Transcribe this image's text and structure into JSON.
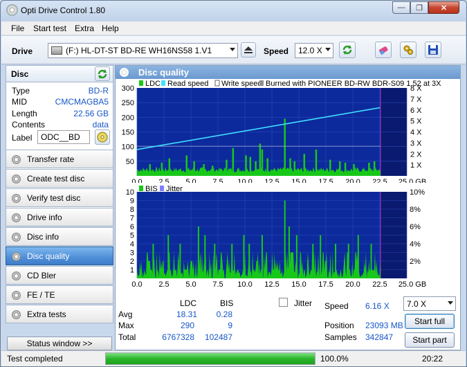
{
  "window": {
    "title": "Opti Drive Control 1.80",
    "min": "—",
    "max": "❐",
    "close": "✕"
  },
  "menu": [
    "File",
    "Start test",
    "Extra",
    "Help"
  ],
  "toolbar": {
    "drive_label": "Drive",
    "drive_value": "(F:)  HL-DT-ST BD-RE  WH16NS58 1.V1",
    "speed_label": "Speed",
    "speed_value": "12.0 X"
  },
  "disc": {
    "header": "Disc",
    "type_label": "Type",
    "type": "BD-R",
    "mid_label": "MID",
    "mid": "CMCMAGBA5",
    "length_label": "Length",
    "length": "22.56 GB",
    "contents_label": "Contents",
    "contents": "data",
    "label_label": "Label",
    "label": "ODC__BD"
  },
  "nav": [
    "Transfer rate",
    "Create test disc",
    "Verify test disc",
    "Drive info",
    "Disc info",
    "Disc quality",
    "CD Bler",
    "FE / TE",
    "Extra tests"
  ],
  "nav_active": 5,
  "status_window": "Status window >>",
  "panel": {
    "title": "Disc quality"
  },
  "chart_data": [
    {
      "type": "area",
      "legend": [
        "LDC",
        "Read speed",
        "Write speed",
        "Burned with PIONEER BD-RW   BDR-S09 1.52 at 3X"
      ],
      "colors": {
        "LDC": "#18c818",
        "read": "#40e0ff",
        "write": "#ffffff",
        "bg": "#0c2a9c",
        "bg_unused": "#0a1a70"
      },
      "xlim": [
        0,
        25
      ],
      "ylim": [
        0,
        300
      ],
      "y2lim": [
        0,
        8
      ],
      "x_ticks": [
        "0.0",
        "2.5",
        "5.0",
        "7.5",
        "10.0",
        "12.5",
        "15.0",
        "17.5",
        "20.0",
        "22.5",
        "25.0 GB"
      ],
      "y_ticks": [
        "50",
        "100",
        "150",
        "200",
        "250",
        "300"
      ],
      "y2_ticks": [
        "1 X",
        "2 X",
        "3 X",
        "4 X",
        "5 X",
        "6 X",
        "7 X",
        "8 X"
      ],
      "data_end": 22.56,
      "ldc_spikes": [
        [
          1.2,
          40
        ],
        [
          2.3,
          45
        ],
        [
          3.0,
          60
        ],
        [
          4.6,
          70
        ],
        [
          5.3,
          50
        ],
        [
          6.2,
          40
        ],
        [
          7.0,
          35
        ],
        [
          8.3,
          55
        ],
        [
          8.9,
          95
        ],
        [
          10.1,
          70
        ],
        [
          10.5,
          65
        ],
        [
          11.0,
          50
        ],
        [
          11.4,
          110
        ],
        [
          11.6,
          90
        ],
        [
          12.1,
          60
        ],
        [
          13.7,
          195
        ],
        [
          14.2,
          60
        ],
        [
          14.6,
          50
        ],
        [
          15.5,
          75
        ],
        [
          16.6,
          90
        ],
        [
          17.9,
          55
        ],
        [
          18.8,
          50
        ],
        [
          19.3,
          45
        ],
        [
          20.1,
          40
        ],
        [
          21.5,
          45
        ],
        [
          22.0,
          50
        ]
      ],
      "read_speed": [
        [
          0,
          2.4
        ],
        [
          22.5,
          6.2
        ]
      ]
    },
    {
      "type": "bar",
      "legend": [
        "BIS",
        "Jitter"
      ],
      "colors": {
        "BIS": "#18c818",
        "Jitter": "#8080ff"
      },
      "xlim": [
        0,
        25
      ],
      "ylim": [
        0,
        10
      ],
      "x_ticks": [
        "0.0",
        "2.5",
        "5.0",
        "7.5",
        "10.0",
        "12.5",
        "15.0",
        "17.5",
        "20.0",
        "22.5",
        "25.0 GB"
      ],
      "y_ticks": [
        "1",
        "2",
        "3",
        "4",
        "5",
        "6",
        "7",
        "8",
        "9",
        "10"
      ],
      "y2_ticks": [
        "2%",
        "4%",
        "6%",
        "8%",
        "10%"
      ],
      "data_end": 22.56,
      "bis_spikes": [
        [
          1.5,
          4
        ],
        [
          2.9,
          5
        ],
        [
          4.0,
          4
        ],
        [
          5.7,
          6
        ],
        [
          6.3,
          5
        ],
        [
          7.2,
          4
        ],
        [
          8.8,
          4
        ],
        [
          9.9,
          5
        ],
        [
          10.4,
          4
        ],
        [
          11.6,
          5
        ],
        [
          13.7,
          9
        ],
        [
          14.1,
          6
        ],
        [
          14.8,
          5
        ],
        [
          16.3,
          4
        ],
        [
          17.0,
          5
        ],
        [
          18.4,
          4
        ],
        [
          19.6,
          4
        ],
        [
          20.5,
          5
        ],
        [
          21.7,
          4
        ]
      ]
    }
  ],
  "stats": {
    "col_ldc": "LDC",
    "col_bis": "BIS",
    "avg_label": "Avg",
    "avg_ldc": "18.31",
    "avg_bis": "0.28",
    "max_label": "Max",
    "max_ldc": "290",
    "max_bis": "9",
    "total_label": "Total",
    "total_ldc": "6767328",
    "total_bis": "102487",
    "jitter_label": "Jitter",
    "speed_label": "Speed",
    "speed": "6.16 X",
    "position_label": "Position",
    "position": "23093 MB",
    "samples_label": "Samples",
    "samples": "342847",
    "speed_select": "7.0 X",
    "start_full": "Start full",
    "start_part": "Start part"
  },
  "status": {
    "text": "Test completed",
    "progress": 100,
    "progress_text": "100.0%",
    "time": "20:22"
  }
}
